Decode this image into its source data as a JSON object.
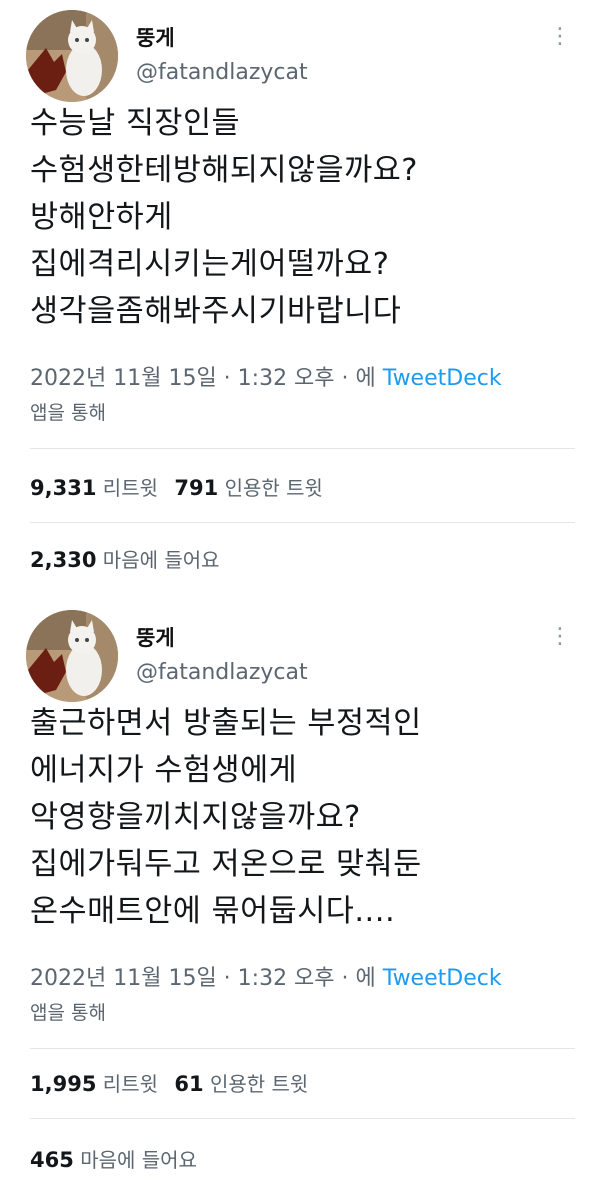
{
  "tweets": [
    {
      "display_name": "뚱게",
      "handle": "@fatandlazycat",
      "lines": [
        "수능날 직장인들",
        "수험생한테방해되지않을까요?",
        "방해안하게",
        "집에격리시키는게어떨까요?",
        "생각을좀해봐주시기바랍니다"
      ],
      "timestamp": "2022년 11월 15일 · 1:32 오후 · 에",
      "source": "TweetDeck",
      "via": "앱을 통해",
      "retweets_count": "9,331",
      "retweets_label": "리트윗",
      "quotes_count": "791",
      "quotes_label": "인용한 트윗",
      "likes_count": "2,330",
      "likes_label": "마음에 들어요"
    },
    {
      "display_name": "뚱게",
      "handle": "@fatandlazycat",
      "lines": [
        "출근하면서 방출되는 부정적인",
        "에너지가 수험생에게",
        "악영향을끼치지않을까요?",
        "집에가둬두고 저온으로 맞춰둔",
        "온수매트안에 묶어둡시다...."
      ],
      "timestamp": "2022년 11월 15일 · 1:32 오후 · 에",
      "source": "TweetDeck",
      "via": "앱을 통해",
      "retweets_count": "1,995",
      "retweets_label": "리트윗",
      "quotes_count": "61",
      "quotes_label": "인용한 트윗",
      "likes_count": "465",
      "likes_label": "마음에 들어요"
    }
  ],
  "icons": {
    "more": "more-vertical-icon",
    "avatar": "cat-avatar"
  },
  "colors": {
    "link": "#1d9bf0",
    "secondary": "#5b6670"
  }
}
